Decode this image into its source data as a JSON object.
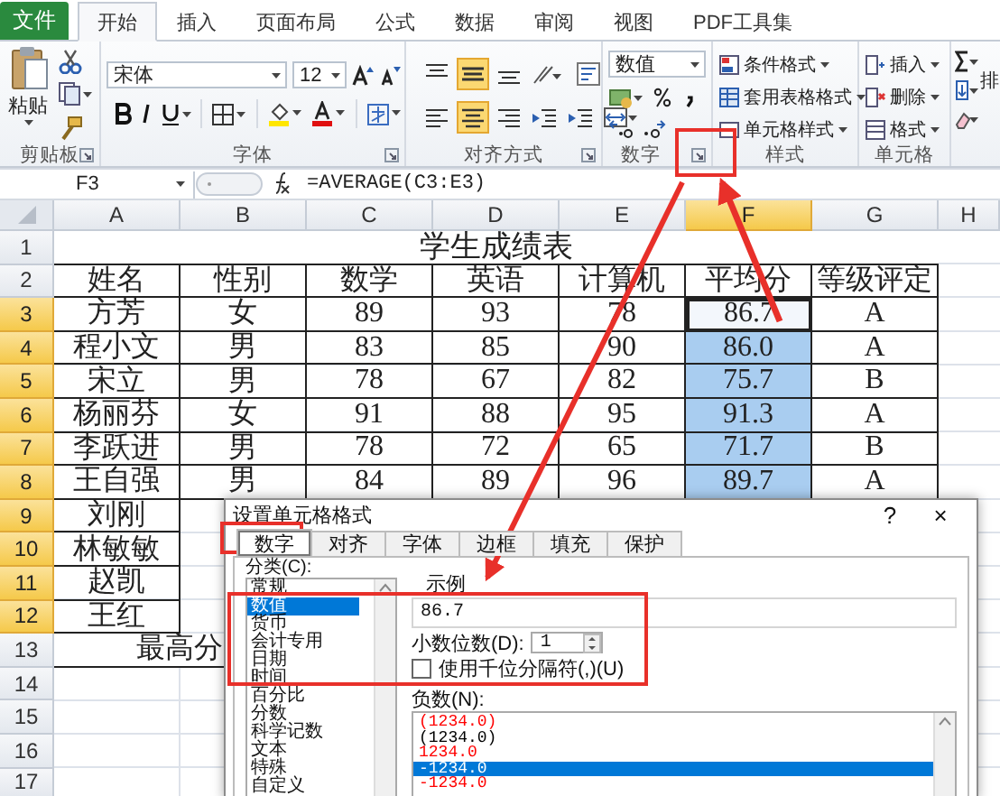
{
  "ribbon": {
    "file_tab": "文件",
    "tabs": [
      {
        "label": "开始",
        "selected": true
      },
      {
        "label": "插入",
        "selected": false
      },
      {
        "label": "页面布局",
        "selected": false
      },
      {
        "label": "公式",
        "selected": false
      },
      {
        "label": "数据",
        "selected": false
      },
      {
        "label": "审阅",
        "selected": false
      },
      {
        "label": "视图",
        "selected": false
      },
      {
        "label": "PDF工具集",
        "selected": false
      }
    ],
    "groups": [
      {
        "kind": "clipboard",
        "label": "剪贴板",
        "paste": "粘贴"
      },
      {
        "kind": "font",
        "label": "字体",
        "font_name": "宋体",
        "font_size": "12"
      },
      {
        "kind": "alignment",
        "label": "对齐方式",
        "buttons": [
          {
            "kind": "top",
            "selected": false
          },
          {
            "kind": "middle",
            "selected": true
          },
          {
            "kind": "bottom",
            "selected": false
          },
          {
            "kind": "orientation",
            "selected": false
          },
          {
            "kind": "wrap",
            "selected": false
          },
          {
            "kind": "left",
            "selected": false
          },
          {
            "kind": "center",
            "selected": true
          },
          {
            "kind": "right",
            "selected": false
          },
          {
            "kind": "outdent",
            "selected": false
          },
          {
            "kind": "indent",
            "selected": false
          },
          {
            "kind": "merge",
            "selected": false
          }
        ]
      },
      {
        "kind": "number",
        "label": "数字",
        "format": "数值"
      },
      {
        "kind": "styles",
        "label": "样式",
        "items": [
          "条件格式",
          "套用表格格式",
          "单元格样式"
        ]
      },
      {
        "kind": "cells",
        "label": "单元格",
        "items": [
          "插入",
          "删除",
          "格式"
        ]
      },
      {
        "kind": "editing",
        "cut_label": "排"
      }
    ]
  },
  "formula_bar": {
    "name_box": "F3",
    "formula": "=AVERAGE(C3:E3)"
  },
  "sheet": {
    "columns": [
      {
        "label": "A",
        "selected": false
      },
      {
        "label": "B",
        "selected": false
      },
      {
        "label": "C",
        "selected": false
      },
      {
        "label": "D",
        "selected": false
      },
      {
        "label": "E",
        "selected": false
      },
      {
        "label": "F",
        "selected": true
      },
      {
        "label": "G",
        "selected": false
      },
      {
        "label": "H",
        "selected": false
      }
    ],
    "rows": [
      {
        "kind": "title",
        "header": "1",
        "selected": false,
        "text": "学生成绩表"
      },
      {
        "kind": "data",
        "header": "2",
        "selected": false,
        "cells": [
          {
            "text": "姓名",
            "selected": false
          },
          {
            "text": "性别",
            "selected": false
          },
          {
            "text": "数学",
            "selected": false
          },
          {
            "text": "英语",
            "selected": false
          },
          {
            "text": "计算机",
            "selected": false
          },
          {
            "text": "平均分",
            "selected": false
          },
          {
            "text": "等级评定",
            "selected": false
          }
        ]
      },
      {
        "kind": "data",
        "header": "3",
        "selected": true,
        "cells": [
          {
            "text": "方芳",
            "selected": false
          },
          {
            "text": "女",
            "selected": false
          },
          {
            "text": "89",
            "selected": false
          },
          {
            "text": "93",
            "selected": false
          },
          {
            "text": "78",
            "selected": false
          },
          {
            "text": "86.7",
            "selected": true
          },
          {
            "text": "A",
            "selected": false
          }
        ]
      },
      {
        "kind": "data",
        "header": "4",
        "selected": true,
        "cells": [
          {
            "text": "程小文",
            "selected": false
          },
          {
            "text": "男",
            "selected": false
          },
          {
            "text": "83",
            "selected": false
          },
          {
            "text": "85",
            "selected": false
          },
          {
            "text": "90",
            "selected": false
          },
          {
            "text": "86.0",
            "selected": true
          },
          {
            "text": "A",
            "selected": false
          }
        ]
      },
      {
        "kind": "data",
        "header": "5",
        "selected": true,
        "cells": [
          {
            "text": "宋立",
            "selected": false
          },
          {
            "text": "男",
            "selected": false
          },
          {
            "text": "78",
            "selected": false
          },
          {
            "text": "67",
            "selected": false
          },
          {
            "text": "82",
            "selected": false
          },
          {
            "text": "75.7",
            "selected": true
          },
          {
            "text": "B",
            "selected": false
          }
        ]
      },
      {
        "kind": "data",
        "header": "6",
        "selected": true,
        "cells": [
          {
            "text": "杨丽芬",
            "selected": false
          },
          {
            "text": "女",
            "selected": false
          },
          {
            "text": "91",
            "selected": false
          },
          {
            "text": "88",
            "selected": false
          },
          {
            "text": "95",
            "selected": false
          },
          {
            "text": "91.3",
            "selected": true
          },
          {
            "text": "A",
            "selected": false
          }
        ]
      },
      {
        "kind": "data",
        "header": "7",
        "selected": true,
        "cells": [
          {
            "text": "李跃进",
            "selected": false
          },
          {
            "text": "男",
            "selected": false
          },
          {
            "text": "78",
            "selected": false
          },
          {
            "text": "72",
            "selected": false
          },
          {
            "text": "65",
            "selected": false
          },
          {
            "text": "71.7",
            "selected": true
          },
          {
            "text": "B",
            "selected": false
          }
        ]
      },
      {
        "kind": "data",
        "header": "8",
        "selected": true,
        "cells": [
          {
            "text": "王自强",
            "selected": false
          },
          {
            "text": "男",
            "selected": false
          },
          {
            "text": "84",
            "selected": false
          },
          {
            "text": "89",
            "selected": false
          },
          {
            "text": "96",
            "selected": false
          },
          {
            "text": "89.7",
            "selected": true
          },
          {
            "text": "A",
            "selected": false
          }
        ]
      },
      {
        "kind": "data",
        "header": "9",
        "selected": true,
        "cells": [
          {
            "text": "刘刚",
            "selected": false
          }
        ]
      },
      {
        "kind": "data",
        "header": "10",
        "selected": true,
        "cells": [
          {
            "text": "林敏敏",
            "selected": false
          }
        ]
      },
      {
        "kind": "data",
        "header": "11",
        "selected": true,
        "cells": [
          {
            "text": "赵凯",
            "selected": false
          }
        ]
      },
      {
        "kind": "data",
        "header": "12",
        "selected": true,
        "cells": [
          {
            "text": "王红",
            "selected": false
          }
        ]
      },
      {
        "kind": "footer",
        "header": "13",
        "selected": false,
        "text": "最高分"
      },
      {
        "kind": "empty",
        "header": "14",
        "selected": false
      },
      {
        "kind": "empty",
        "header": "15",
        "selected": false
      },
      {
        "kind": "empty",
        "header": "16",
        "selected": false
      },
      {
        "kind": "empty",
        "header": "17",
        "selected": false
      }
    ]
  },
  "dialog": {
    "title": "设置单元格格式",
    "help": "?",
    "close": "×",
    "tabs": [
      {
        "label": "数字",
        "selected": true
      },
      {
        "label": "对齐",
        "selected": false
      },
      {
        "label": "字体",
        "selected": false
      },
      {
        "label": "边框",
        "selected": false
      },
      {
        "label": "填充",
        "selected": false
      },
      {
        "label": "保护",
        "selected": false
      }
    ],
    "category_label": "分类(C):",
    "categories": [
      {
        "label": "常规",
        "selected": false
      },
      {
        "label": "数值",
        "selected": true
      },
      {
        "label": "货币",
        "selected": false
      },
      {
        "label": "会计专用",
        "selected": false
      },
      {
        "label": "日期",
        "selected": false
      },
      {
        "label": "时间",
        "selected": false
      },
      {
        "label": "百分比",
        "selected": false
      },
      {
        "label": "分数",
        "selected": false
      },
      {
        "label": "科学记数",
        "selected": false
      },
      {
        "label": "文本",
        "selected": false
      },
      {
        "label": "特殊",
        "selected": false
      },
      {
        "label": "自定义",
        "selected": false
      }
    ],
    "sample_label": "示例",
    "sample_value": "86.7",
    "decimal_label": "小数位数(D):",
    "decimal_value": "1",
    "thousands": {
      "label": "使用千位分隔符(,)(U)",
      "checked": false
    },
    "negative_label": "负数(N):",
    "negatives": [
      {
        "text": "(1234.0)",
        "color": "#ff0000",
        "selected": false
      },
      {
        "text": "(1234.0)",
        "color": "#000000",
        "selected": false
      },
      {
        "text": "1234.0",
        "color": "#ff0000",
        "selected": false
      },
      {
        "text": "-1234.0",
        "selected": true
      },
      {
        "text": "-1234.0",
        "color": "#ff0000",
        "selected": false
      }
    ]
  }
}
